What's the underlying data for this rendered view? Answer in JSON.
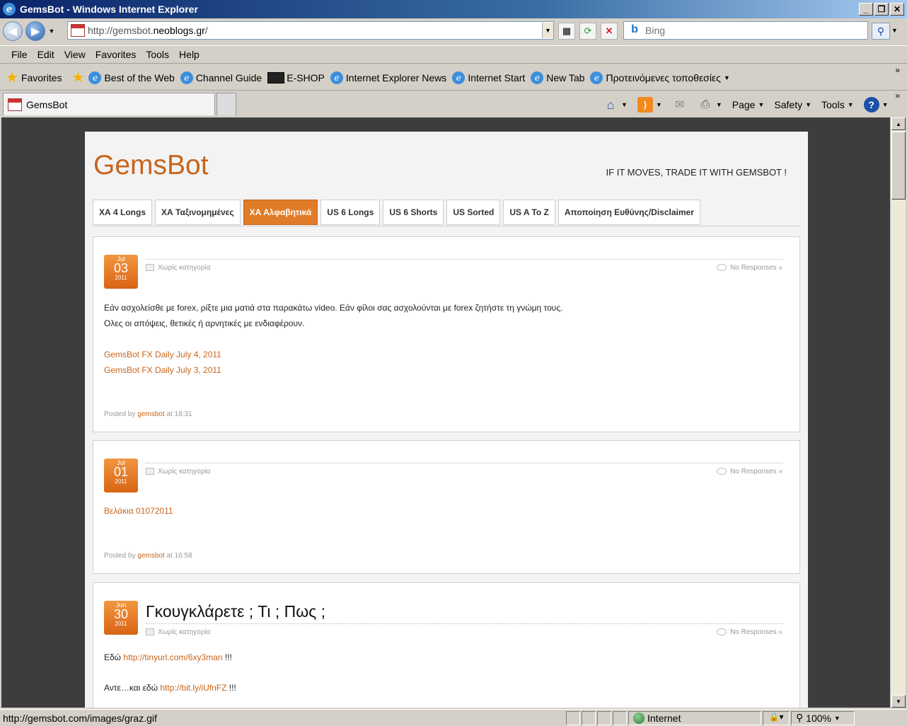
{
  "window": {
    "title": "GemsBot - Windows Internet Explorer"
  },
  "address": {
    "prefix": "http://gemsbot.",
    "domain": "neoblogs.gr",
    "suffix": "/"
  },
  "search": {
    "placeholder": "Bing"
  },
  "menu": [
    "File",
    "Edit",
    "View",
    "Favorites",
    "Tools",
    "Help"
  ],
  "favorites": {
    "label": "Favorites",
    "items": [
      "Best of the Web",
      "Channel Guide",
      "E-SHOP",
      "Internet Explorer News",
      "Internet Start",
      "New Tab",
      "Προτεινόμενες τοποθεσίες"
    ]
  },
  "tab": {
    "label": "GemsBot"
  },
  "commandbar": {
    "page": "Page",
    "safety": "Safety",
    "tools": "Tools"
  },
  "site": {
    "title": "GemsBot",
    "tagline": "IF IT MOVES, TRADE IT WITH GEMSBOT !",
    "nav": [
      "ΧΑ 4 Longs",
      "ΧΑ Ταξινομημένες",
      "ΧΑ Αλφαβητικά",
      "US 6 Longs",
      "US 6 Shorts",
      "US Sorted",
      "US A To Z",
      "Αποποίηση Ευθύνης/Disclaimer"
    ],
    "active_nav": 2
  },
  "posts": [
    {
      "month": "Jul",
      "day": "03",
      "year": "2011",
      "category": "Χωρίς κατηγορία",
      "responses": "No Responses »",
      "line1": "Εάν ασχολείσθε με forex, ρίξτε μια ματιά στα παρακάτω video. Εάν φίλοι σας ασχολούνται με forex ζητήστε τη γνώμη τους.",
      "line2": "Ολες οι απόψεις, θετικές ή αρνητικές με ενδιαφέρουν.",
      "link1": "GemsBot FX Daily July 4, 2011",
      "link2": "GemsBot FX Daily July 3, 2011",
      "posted_prefix": "Posted by",
      "author": "gemsbot",
      "at": "at 18:31"
    },
    {
      "month": "Jul",
      "day": "01",
      "year": "2011",
      "category": "Χωρίς κατηγορία",
      "responses": "No Responses »",
      "link1": "Βελάκια 01072011",
      "posted_prefix": "Posted by",
      "author": "gemsbot",
      "at": "at 16:58"
    },
    {
      "month": "Jun",
      "day": "30",
      "year": "2011",
      "title": "Γκουγκλάρετε ; Τι ; Πως ;",
      "category": "Χωρίς κατηγορία",
      "responses": "No Responses »",
      "line1_prefix": "Εδώ",
      "line1_link": "http://tinyurl.com/6xy3man",
      "line1_suffix": "!!!",
      "line2_prefix": "Αντε…και εδώ",
      "line2_link": "http://bit.ly/iUfnFZ",
      "line2_suffix": "!!!"
    }
  ],
  "status": {
    "url": "http://gemsbot.com/images/graz.gif",
    "zone": "Internet",
    "zoom": "100%"
  }
}
